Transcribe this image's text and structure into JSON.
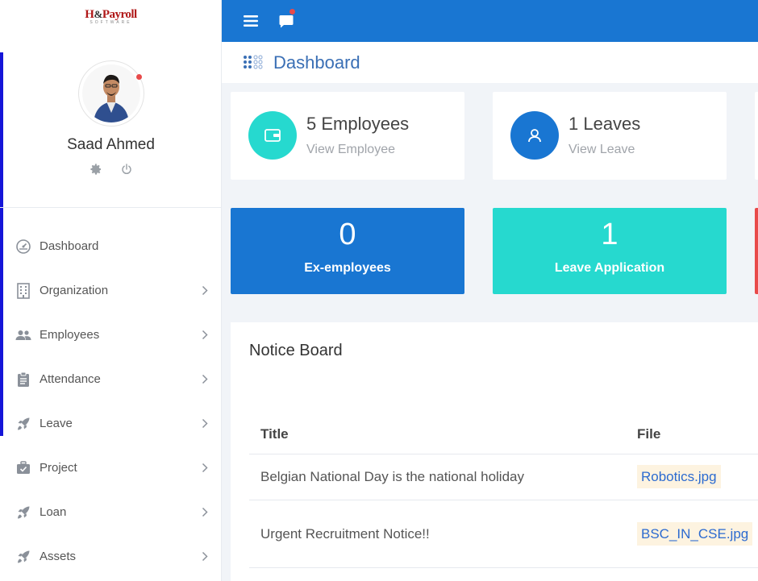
{
  "app": {
    "logo_main_h": "H",
    "logo_main_amp": "&",
    "logo_main_rest": "Payroll",
    "logo_sub": "SOFTWARE"
  },
  "profile": {
    "name": "Saad Ahmed"
  },
  "sidebar": {
    "items": [
      {
        "label": "Dashboard",
        "icon": "gauge-icon",
        "has_submenu": false
      },
      {
        "label": "Organization",
        "icon": "building-icon",
        "has_submenu": true
      },
      {
        "label": "Employees",
        "icon": "people-icon",
        "has_submenu": true
      },
      {
        "label": "Attendance",
        "icon": "clipboard-icon",
        "has_submenu": true
      },
      {
        "label": "Leave",
        "icon": "rocket-icon",
        "has_submenu": true
      },
      {
        "label": "Project",
        "icon": "briefcase-check-icon",
        "has_submenu": true
      },
      {
        "label": "Loan",
        "icon": "rocket-icon",
        "has_submenu": true
      },
      {
        "label": "Assets",
        "icon": "rocket-icon",
        "has_submenu": true
      }
    ]
  },
  "header": {
    "page_title": "Dashboard"
  },
  "cards": [
    {
      "title": "5 Employees",
      "link": "View Employee",
      "color": "#26d9cf",
      "icon": "wallet-icon"
    },
    {
      "title": "1 Leaves",
      "link": "View Leave",
      "color": "#1976d2",
      "icon": "user-icon"
    }
  ],
  "tiles": [
    {
      "value": "0",
      "label": "Ex-employees",
      "color": "#1976d2"
    },
    {
      "value": "1",
      "label": "Leave Application",
      "color": "#26d9cf"
    }
  ],
  "notice_board": {
    "title": "Notice Board",
    "columns": [
      "Title",
      "File"
    ],
    "rows": [
      {
        "title": "Belgian National Day is the national holiday",
        "file": "Robotics.jpg"
      },
      {
        "title": "Urgent Recruitment Notice!!",
        "file": "BSC_IN_CSE.jpg"
      }
    ]
  },
  "colors": {
    "primary": "#1976d2",
    "accent": "#26d9cf",
    "sidebar_accent": "#1515d8",
    "title_blue": "#3a6fb5",
    "alert_red": "#e84a4a"
  }
}
